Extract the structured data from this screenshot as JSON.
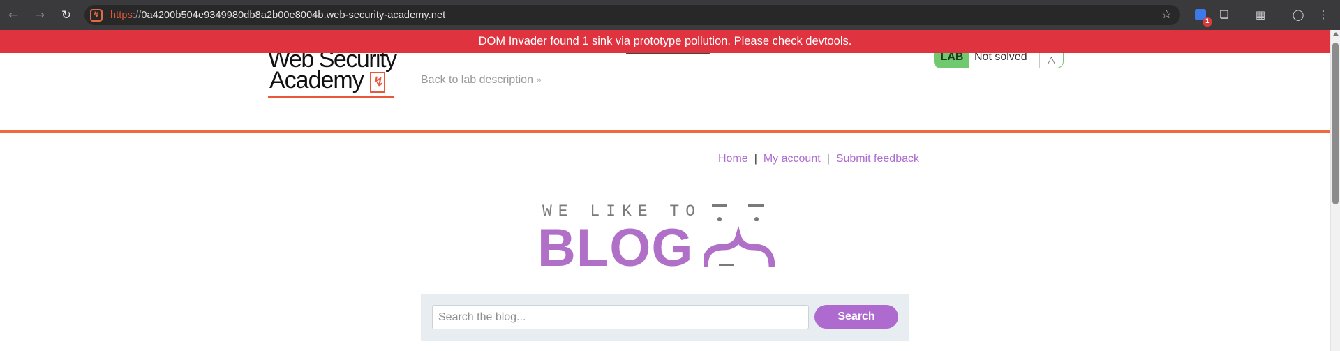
{
  "browser": {
    "url_protocol": "https",
    "url_separator": "://",
    "url_host": "0a4200b504e9349980db8a2b00e8004b.web-security-academy.net",
    "extension_badge": "1",
    "icons": [
      "back-icon",
      "forward-icon",
      "reload-icon",
      "site-info-icon",
      "star-icon",
      "dom-invader-icon",
      "extensions-icon",
      "cast-icon",
      "profile-icon",
      "menu-icon"
    ]
  },
  "dom_invader": {
    "message": "DOM Invader found 1 sink via prototype pollution. Please check devtools.",
    "color": "#df3340"
  },
  "lab_header": {
    "logo_line1": "Web Security",
    "logo_line2": "Academy",
    "back_link": "Back to lab description",
    "status_badge": "LAB",
    "status_text": "Not solved"
  },
  "blog": {
    "nav": [
      {
        "label": "Home"
      },
      {
        "label": "My account"
      },
      {
        "label": "Submit feedback"
      }
    ],
    "nav_separator": "|",
    "banner_top": "WE LIKE TO",
    "banner_main": "BLOG",
    "accent_color": "#ae6acf"
  },
  "search": {
    "placeholder": "Search the blog...",
    "value": "",
    "button_label": "Search"
  }
}
